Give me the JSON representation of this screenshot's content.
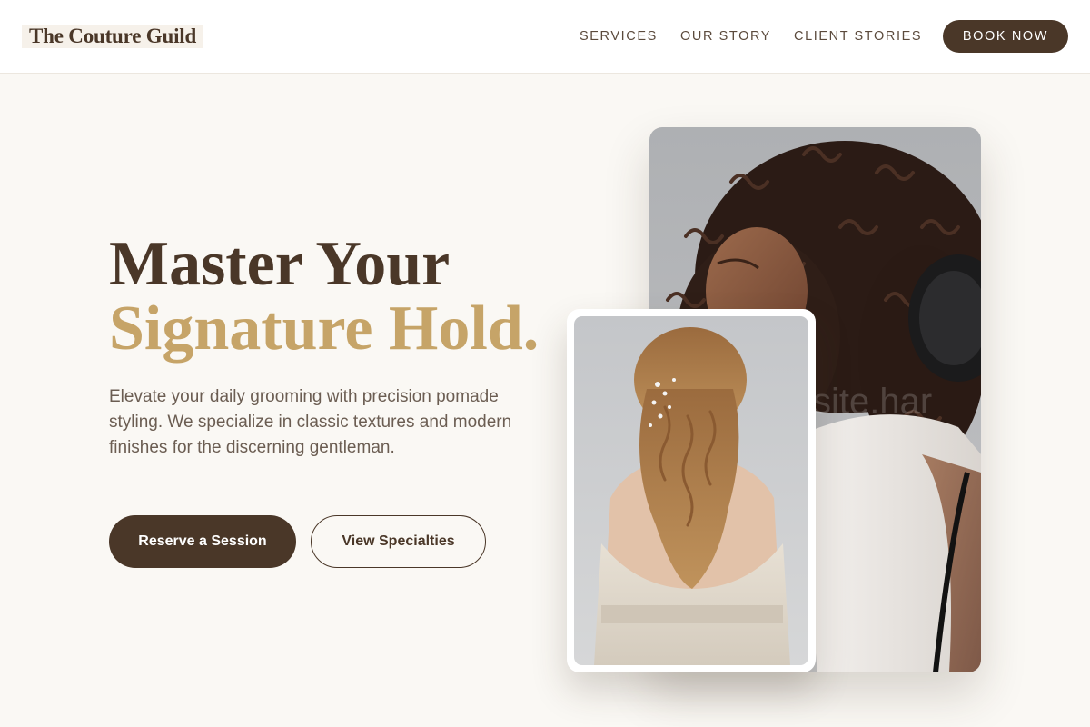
{
  "header": {
    "logo": "The Couture Guild",
    "nav": [
      "SERVICES",
      "OUR STORY",
      "CLIENT STORIES"
    ],
    "cta": "BOOK NOW"
  },
  "hero": {
    "title_line1": "Master Your",
    "title_line2": "Signature Hold.",
    "description": "Elevate your daily grooming with precision pomade styling. We specialize in classic textures and modern finishes for the discerning gentleman.",
    "primary_button": "Reserve a Session",
    "secondary_button": "View Specialties"
  },
  "images": {
    "main": "photo-curly-hair-blowdry",
    "secondary": "photo-bridal-half-up-waves"
  },
  "colors": {
    "brand": "#4a3728",
    "accent": "#c6a468",
    "background": "#faf8f4",
    "body_text": "#6b5d52"
  }
}
